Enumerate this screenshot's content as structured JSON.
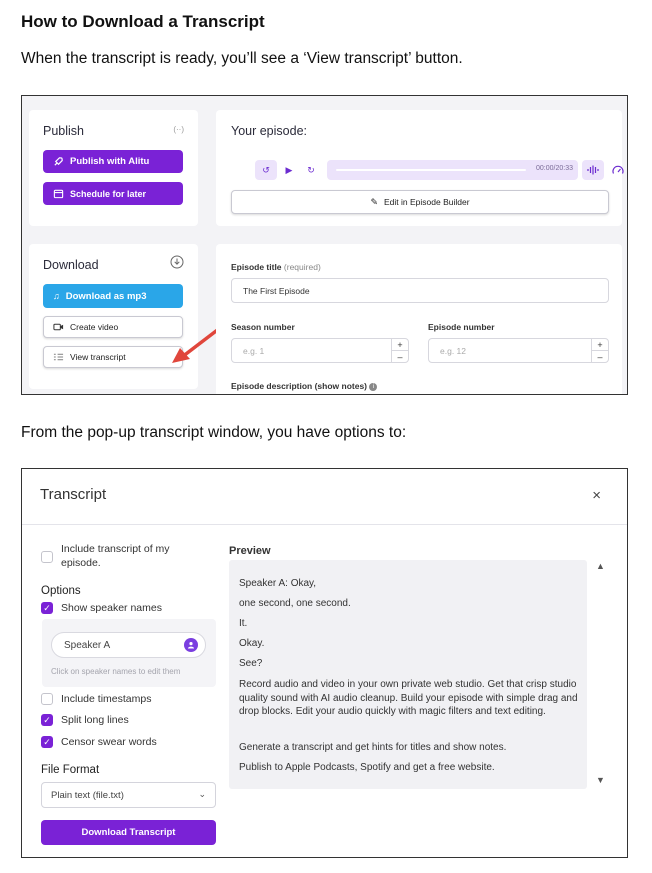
{
  "heading": "How to Download a Transcript",
  "intro": "When the transcript is ready, you’ll see a ‘View transcript’ button.",
  "popup_intro": "From the pop-up transcript window, you have options to:",
  "screenshot1": {
    "publish": {
      "title": "Publish",
      "broadcast_icon": "(··)",
      "publish_btn": "Publish with Alitu",
      "schedule_btn": "Schedule for later"
    },
    "download": {
      "title": "Download",
      "mp3_btn": "Download as mp3",
      "video_btn": "Create video",
      "transcript_btn": "View transcript"
    },
    "episode": {
      "title": "Your episode:",
      "time": "00:00/20:33",
      "edit_btn": "Edit in Episode Builder",
      "title_label": "Episode title",
      "title_required": "(required)",
      "title_value": "The First Episode",
      "season_label": "Season number",
      "season_placeholder": "e.g. 1",
      "episode_label": "Episode number",
      "episode_placeholder": "e.g. 12",
      "description_label": "Episode description (show notes)"
    },
    "colors": {
      "purple": "#7a22d6",
      "blue": "#2aa6e8",
      "arrow": "#e0463c"
    }
  },
  "screenshot2": {
    "title": "Transcript",
    "close": "×",
    "include_label": "Include transcript of my episode.",
    "options_label": "Options",
    "show_speaker_names": "Show speaker names",
    "speaker_value": "Speaker A",
    "speaker_hint": "Click on speaker names to edit them",
    "include_timestamps": "Include timestamps",
    "split_long_lines": "Split long lines",
    "censor_swear_words": "Censor swear words",
    "file_format_label": "File Format",
    "file_format_value": "Plain text (file.txt)",
    "download_btn": "Download Transcript",
    "preview_label": "Preview",
    "preview_lines": [
      "Speaker A: Okay,",
      "one second, one second.",
      "It.",
      "Okay.",
      "See?",
      "Record audio and video in your own private web studio. Get that crisp studio quality sound with AI audio cleanup. Build your episode with simple drag and drop blocks. Edit your audio quickly with magic filters and text editing.",
      "Generate a transcript and get hints for titles and show notes.",
      "Publish to Apple Podcasts, Spotify and get a free website."
    ],
    "checkbox_states": {
      "include_transcript": false,
      "show_speaker_names": true,
      "include_timestamps": false,
      "split_long_lines": true,
      "censor_swear_words": true
    }
  }
}
